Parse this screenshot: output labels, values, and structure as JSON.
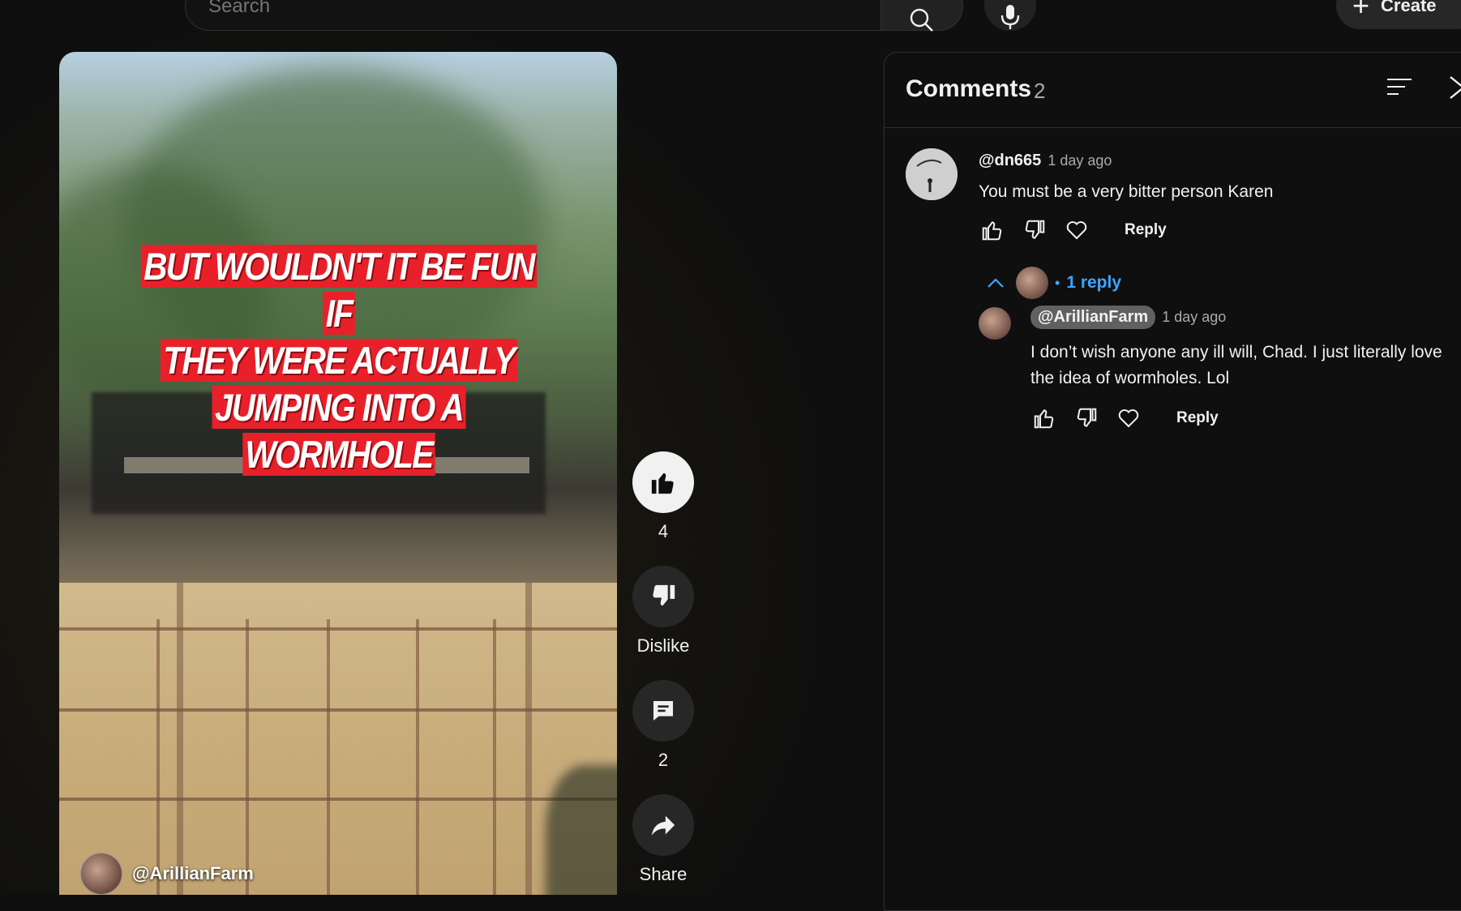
{
  "topbar": {
    "search_placeholder": "Search",
    "create_label": "Create"
  },
  "video": {
    "caption_lines": [
      "BUT WOULDN'T IT BE FUN IF",
      "THEY WERE ACTUALLY",
      "JUMPING INTO A WORMHOLE"
    ],
    "channel_name": "@ArillianFarm"
  },
  "actions": {
    "like_count": "4",
    "dislike_label": "Dislike",
    "comment_count": "2",
    "share_label": "Share"
  },
  "comments_panel": {
    "title": "Comments",
    "count": "2",
    "comments": [
      {
        "handle": "@dn665",
        "time": "1 day ago",
        "text": "You must be a very bitter person Karen",
        "reply_label": "Reply",
        "replies_toggle": "1 reply",
        "replies": [
          {
            "handle": "@ArillianFarm",
            "time": "1 day ago",
            "text": "I don’t wish anyone any ill will, Chad. I just literally love the idea of wormholes. Lol",
            "reply_label": "Reply"
          }
        ]
      }
    ]
  },
  "colors": {
    "background": "#0f0f0f",
    "link_blue": "#3ea6ff",
    "caption_red": "#e8202a"
  }
}
